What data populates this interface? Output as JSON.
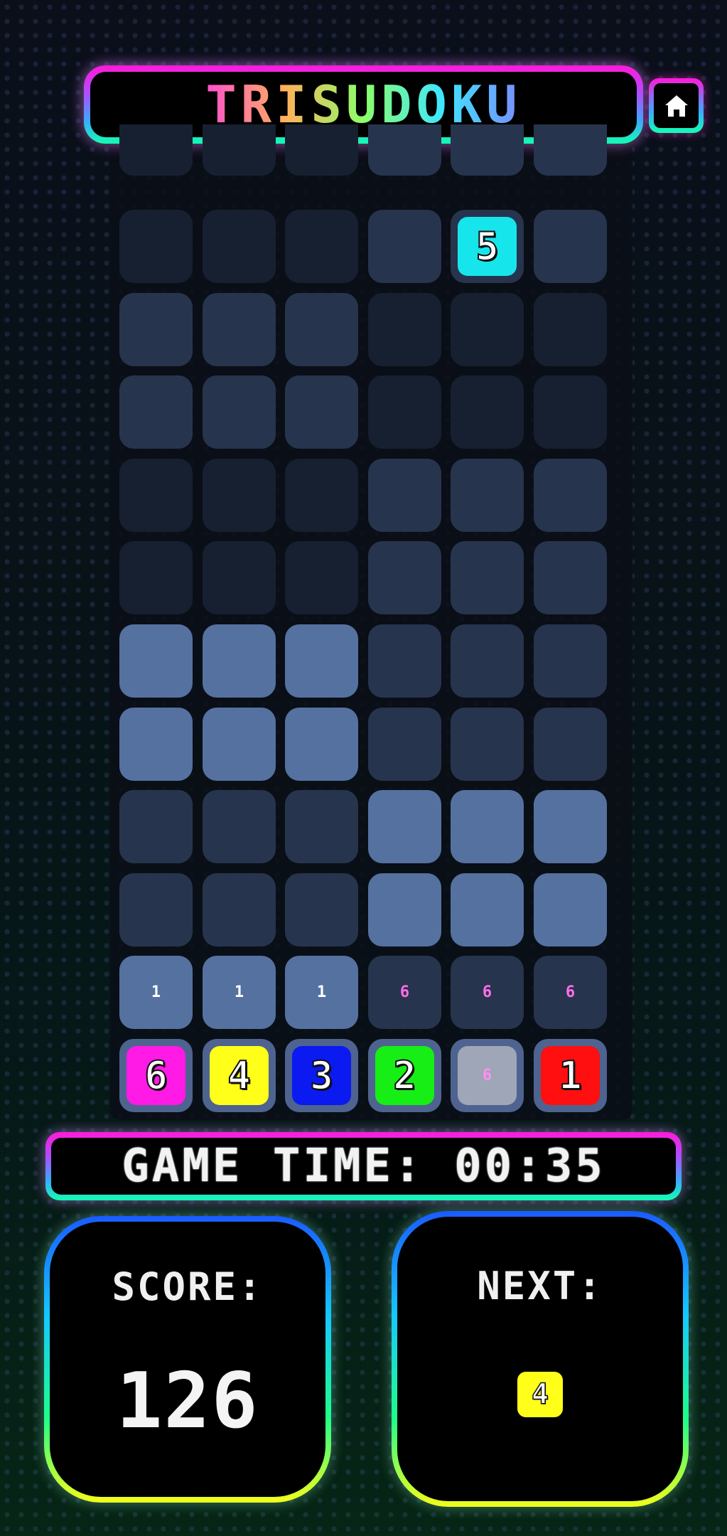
{
  "app": {
    "title": "TRISUDOKU"
  },
  "header": {
    "home_icon": "home-icon"
  },
  "board": {
    "columns": 6,
    "top_row": [
      "dark",
      "dark",
      "dark",
      "mid",
      "mid",
      "mid"
    ],
    "rows": [
      {
        "cells": [
          "dark",
          "dark",
          "dark",
          "mid",
          "mid",
          "mid"
        ],
        "tile": {
          "col": 4,
          "value": "5",
          "color": "#16e6ec"
        }
      },
      {
        "cells": [
          "mid",
          "mid",
          "mid",
          "dark",
          "dark",
          "dark"
        ]
      },
      {
        "cells": [
          "mid",
          "mid",
          "mid",
          "dark",
          "dark",
          "dark"
        ]
      },
      {
        "cells": [
          "dark",
          "dark",
          "dark",
          "mid",
          "mid",
          "mid"
        ]
      },
      {
        "cells": [
          "dark",
          "dark",
          "dark",
          "mid",
          "mid",
          "mid"
        ]
      },
      {
        "cells": [
          "light",
          "light",
          "light",
          "mid",
          "mid",
          "mid"
        ]
      },
      {
        "cells": [
          "light",
          "light",
          "light",
          "mid",
          "mid",
          "mid"
        ]
      },
      {
        "cells": [
          "mid",
          "mid",
          "mid",
          "light",
          "light",
          "light"
        ]
      },
      {
        "cells": [
          "mid",
          "mid",
          "mid",
          "light",
          "light",
          "light"
        ]
      }
    ],
    "count_row": [
      {
        "value": "1",
        "bg": "light",
        "color": "#ffffff"
      },
      {
        "value": "1",
        "bg": "light",
        "color": "#ffffff"
      },
      {
        "value": "1",
        "bg": "light",
        "color": "#ffffff"
      },
      {
        "value": "6",
        "bg": "mid",
        "color": "#ff6fe8"
      },
      {
        "value": "6",
        "bg": "mid",
        "color": "#ff6fe8"
      },
      {
        "value": "6",
        "bg": "mid",
        "color": "#ff6fe8"
      }
    ],
    "piece_row": [
      {
        "value": "6",
        "color": "#ff1ae6",
        "size": "large"
      },
      {
        "value": "4",
        "color": "#ffff1a",
        "size": "large"
      },
      {
        "value": "3",
        "color": "#0a1af0",
        "size": "large"
      },
      {
        "value": "2",
        "color": "#16ee16",
        "size": "large"
      },
      {
        "value": "6",
        "color": "#9ea6b8",
        "size": "small"
      },
      {
        "value": "1",
        "color": "#ff0f0f",
        "size": "large"
      }
    ]
  },
  "game_time": {
    "label": "GAME TIME: 00:35"
  },
  "score": {
    "label": "SCORE:",
    "value": "126"
  },
  "next": {
    "label": "NEXT:",
    "value": "4",
    "color": "#ffff1a"
  }
}
